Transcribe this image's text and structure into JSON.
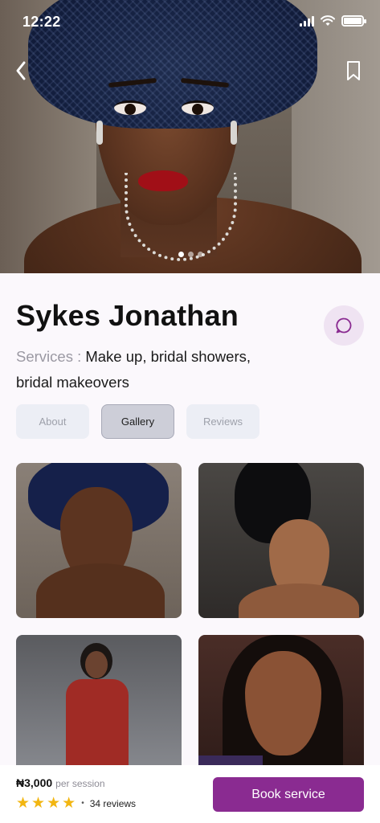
{
  "status_bar": {
    "time": "12:22"
  },
  "hero": {
    "image_alt": "stylist portrait",
    "carousel": {
      "total": 3,
      "active": 1
    },
    "back_icon": "chevron-left-icon",
    "bookmark_icon": "bookmark-icon"
  },
  "profile": {
    "name": "Sykes Jonathan",
    "services_label": "Services :",
    "services_value": "Make up, bridal showers, bridal makeovers",
    "chat_icon": "chat-bubble-icon"
  },
  "tabs": [
    {
      "label": "About",
      "active": false
    },
    {
      "label": "Gallery",
      "active": true
    },
    {
      "label": "Reviews",
      "active": false
    }
  ],
  "gallery": {
    "items": 4
  },
  "booking": {
    "price": "₦3,000",
    "per_label": "per session",
    "rating_stars": 4,
    "reviews": "34 reviews",
    "book_label": "Book service"
  },
  "colors": {
    "accent": "#8a2b91",
    "star": "#f2b611",
    "chat_bg": "#efe3f2",
    "tab_bg": "#eceef5",
    "tab_active_bg": "#cdced8"
  }
}
